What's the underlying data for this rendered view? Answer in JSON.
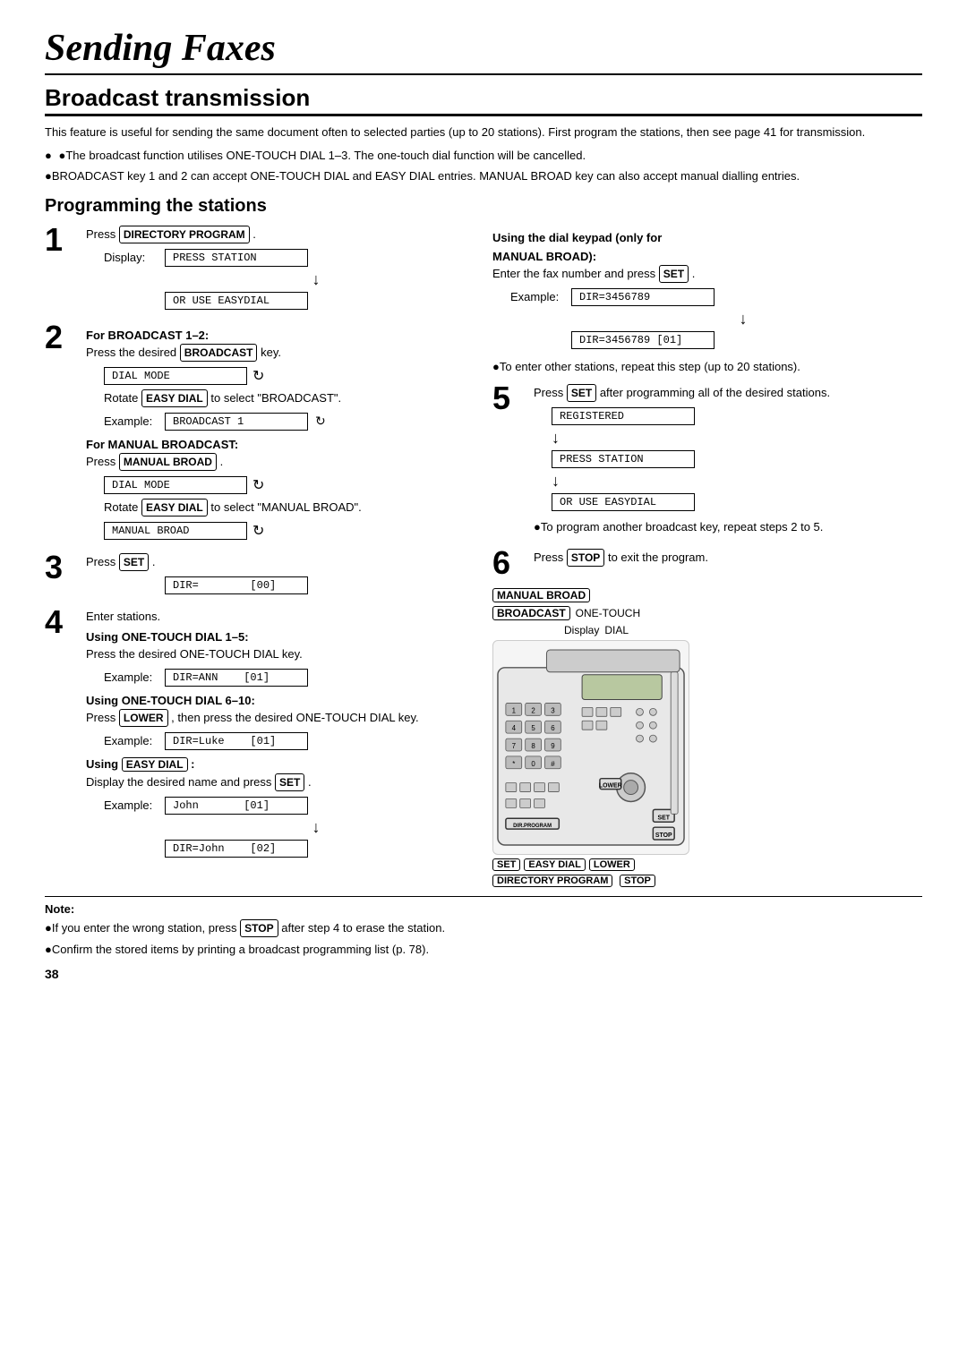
{
  "title": "Sending Faxes",
  "section": "Broadcast transmission",
  "intro": [
    "This feature is useful for sending the same document often to selected parties (up to 20 stations). First program the stations, then see page 41 for transmission.",
    "●The broadcast function utilises ONE-TOUCH DIAL 1–3. The one-touch dial function will be cancelled.",
    "●BROADCAST key 1 and 2 can accept ONE-TOUCH DIAL and EASY DIAL entries. MANUAL BROAD key can also accept manual dialling entries."
  ],
  "programming_title": "Programming the stations",
  "steps": {
    "step1": {
      "number": "1",
      "text": "Press",
      "key": "DIRECTORY PROGRAM",
      "display_label": "Display:",
      "display1": "PRESS STATION",
      "display2": "OR USE EASYDIAL"
    },
    "step2": {
      "number": "2",
      "heading": "For BROADCAST 1–2:",
      "text": "Press the desired",
      "key": "BROADCAST",
      "text2": "key.",
      "display1": "DIAL MODE",
      "symbol": "↻",
      "rotate_text": "Rotate",
      "rotate_key": "EASY DIAL",
      "rotate_desc": "to select \"BROADCAST\".",
      "example_label": "Example:",
      "example_display": "BROADCAST 1",
      "manual_heading": "For MANUAL BROADCAST:",
      "manual_press": "Press",
      "manual_key": "MANUAL BROAD",
      "manual_display": "DIAL MODE",
      "rotate2_text": "Rotate",
      "rotate2_key": "EASY DIAL",
      "rotate2_desc": "to select \"MANUAL BROAD\".",
      "manual_broad_display": "MANUAL BROAD"
    },
    "step3": {
      "number": "3",
      "text": "Press",
      "key": "SET",
      "display1": "DIR=",
      "display2": "[00]"
    },
    "step4": {
      "number": "4",
      "text": "Enter stations.",
      "one_touch_heading": "Using ONE-TOUCH DIAL 1–5:",
      "one_touch_text": "Press the desired ONE-TOUCH DIAL key.",
      "example1_label": "Example:",
      "example1_display": "DIR=ANN",
      "example1_val": "[01]",
      "one_touch2_heading": "Using ONE-TOUCH DIAL 6–10:",
      "one_touch2_text": "Press",
      "one_touch2_key": "LOWER",
      "one_touch2_text2": ", then press the desired ONE-TOUCH DIAL key.",
      "example2_label": "Example:",
      "example2_display": "DIR=Luke",
      "example2_val": "[01]",
      "easy_dial_heading": "Using",
      "easy_dial_key": "EASY DIAL",
      "easy_dial_text": ":",
      "easy_dial_desc": "Display the desired name and press",
      "easy_dial_set": "SET",
      "example3_label": "Example:",
      "example3_display": "John",
      "example3_val": "[01]",
      "example3b_display": "DIR=John",
      "example3b_val": "[02]"
    },
    "step5": {
      "number": "5",
      "text": "Press",
      "key": "SET",
      "text2": "after programming all of the desired stations.",
      "display1": "REGISTERED",
      "display2": "PRESS STATION",
      "display3": "OR USE EASYDIAL",
      "note": "●To program another broadcast key, repeat steps 2 to 5."
    },
    "step6": {
      "number": "6",
      "text": "Press",
      "key": "STOP",
      "text2": "to exit the program."
    }
  },
  "right_col": {
    "dial_keypad_heading": "Using the dial keypad (only for",
    "manual_broad_label": "MANUAL BROAD):",
    "enter_text": "Enter the fax number and press",
    "set_key": "SET",
    "example_label": "Example:",
    "example1": "DIR=3456789",
    "example2": "DIR=3456789 [01]",
    "note1": "●To enter other stations, repeat this step (up to 20 stations)."
  },
  "diagram": {
    "manual_broad_label": "MANUAL BROAD",
    "broadcast_label": "BROADCAST",
    "one_touch_label": "ONE-TOUCH",
    "dial_label": "DIAL",
    "display_label": "Display",
    "set_label": "SET",
    "easy_dial_label": "EASY DIAL",
    "lower_label": "LOWER",
    "directory_program_label": "DIRECTORY PROGRAM",
    "stop_label": "STOP",
    "keypad_keys": [
      "1",
      "2",
      "3",
      "4",
      "5",
      "6",
      "7",
      "8",
      "9",
      "*",
      "0",
      "#"
    ]
  },
  "note": {
    "title": "Note:",
    "bullets": [
      "●If you enter the wrong station, press  STOP  after step 4 to erase the station.",
      "●Confirm the stored items by printing a broadcast programming list (p. 78)."
    ]
  },
  "page_number": "38"
}
